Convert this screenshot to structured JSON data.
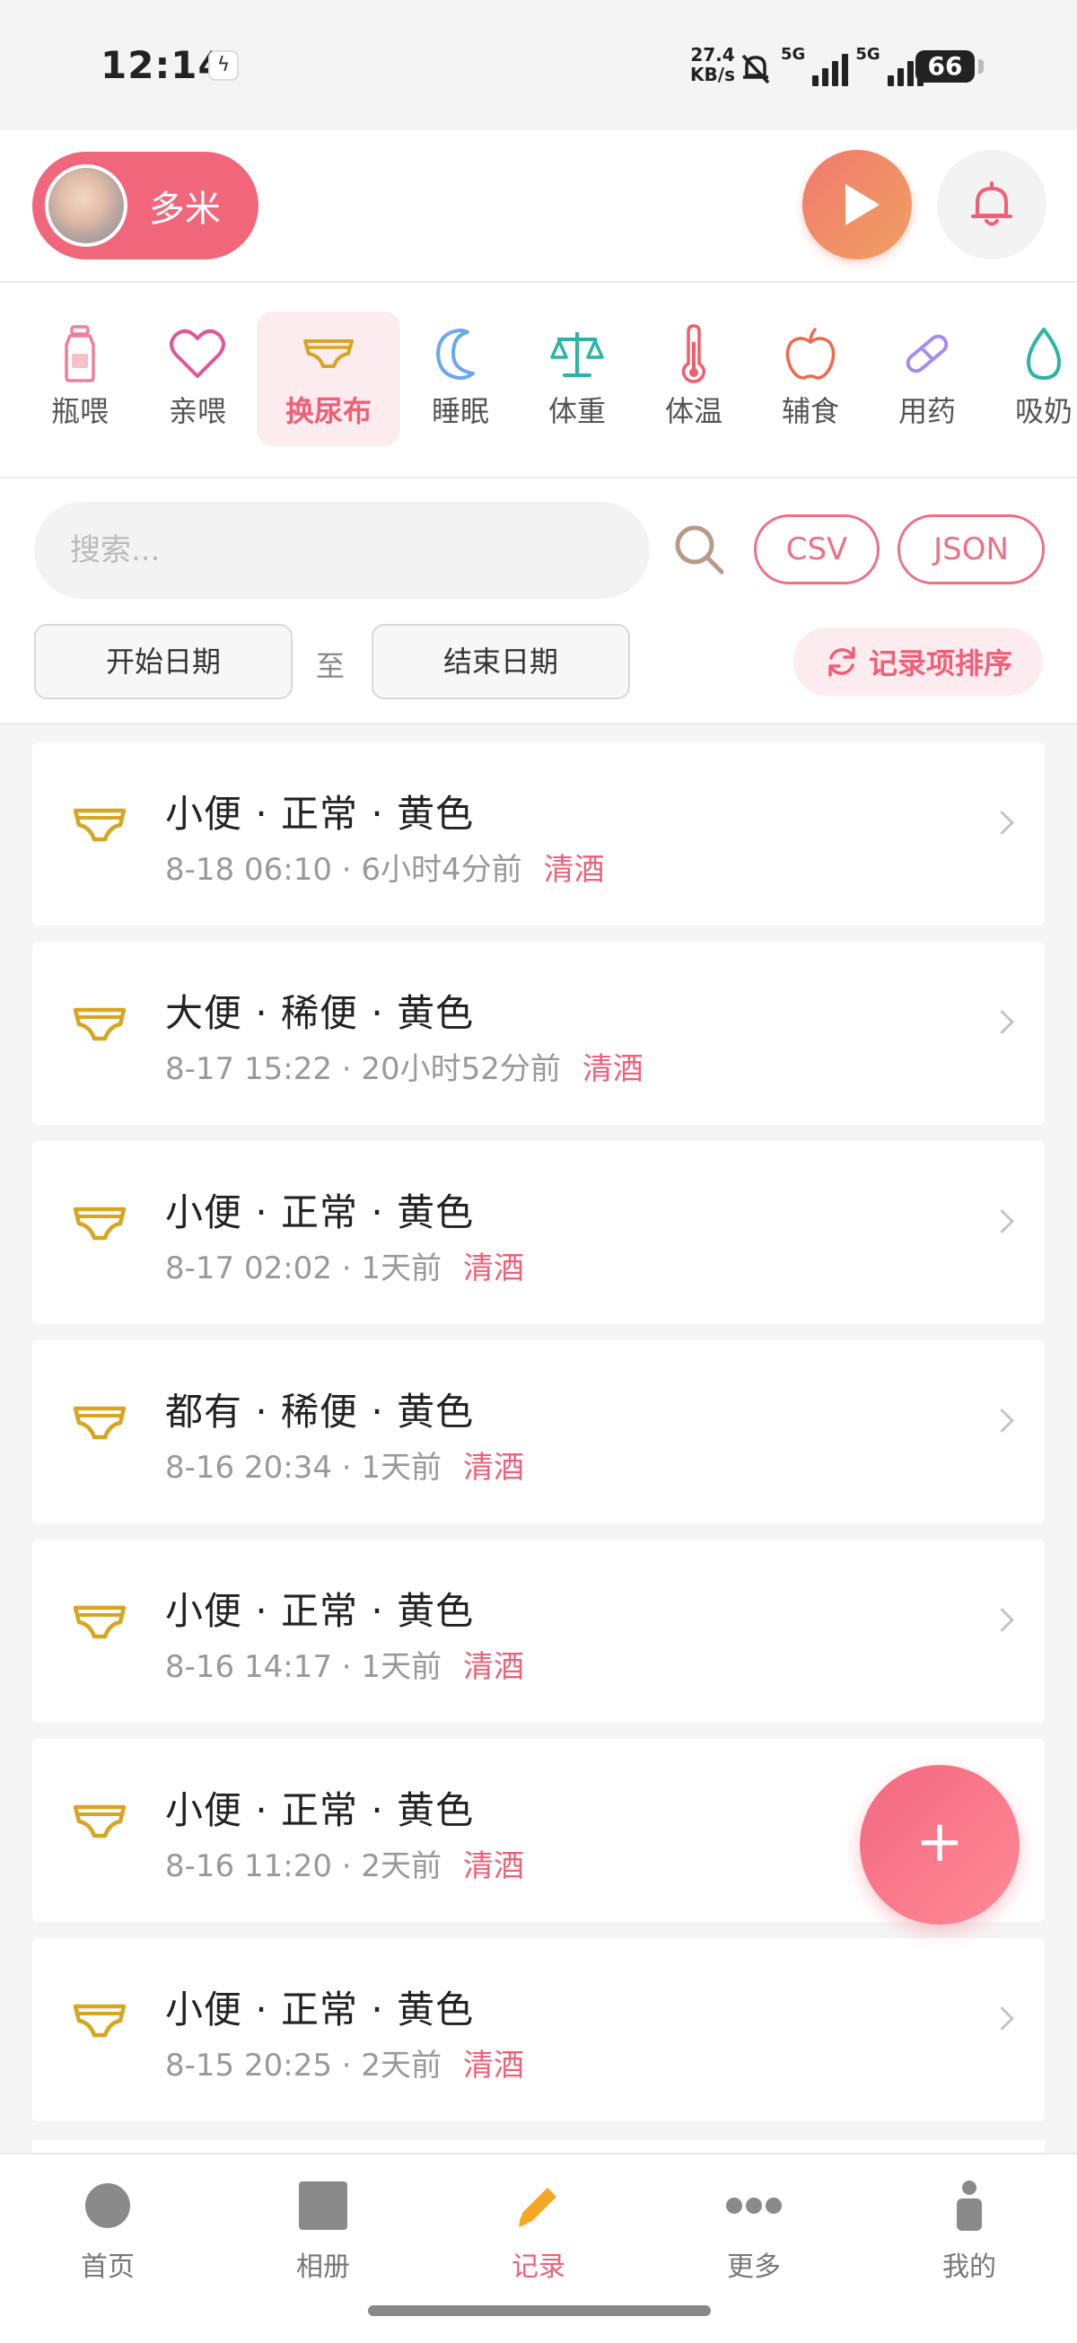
{
  "status_bar": {
    "time": "12:14",
    "speed_value": "27.4",
    "speed_unit": "KB/s",
    "network_1": "5G",
    "network_2": "5G",
    "battery": "66"
  },
  "header": {
    "baby_name": "多米"
  },
  "categories": [
    {
      "label": "瓶喂",
      "icon": "bottle-icon"
    },
    {
      "label": "亲喂",
      "icon": "heart-icon"
    },
    {
      "label": "换尿布",
      "icon": "diaper-icon",
      "active": true
    },
    {
      "label": "睡眠",
      "icon": "moon-icon"
    },
    {
      "label": "体重",
      "icon": "scale-icon"
    },
    {
      "label": "体温",
      "icon": "thermometer-icon"
    },
    {
      "label": "辅食",
      "icon": "apple-icon"
    },
    {
      "label": "用药",
      "icon": "pill-icon"
    },
    {
      "label": "吸奶",
      "icon": "drop-icon"
    }
  ],
  "filter": {
    "search_placeholder": "搜索...",
    "csv_label": "CSV",
    "json_label": "JSON",
    "start_date": "开始日期",
    "separator": "至",
    "end_date": "结束日期",
    "sort_label": "记录项排序"
  },
  "records": [
    {
      "title": "小便 · 正常 · 黄色",
      "time": "8-18 06:10 · 6小时4分前",
      "who": "清酒"
    },
    {
      "title": "大便 · 稀便 · 黄色",
      "time": "8-17 15:22 · 20小时52分前",
      "who": "清酒"
    },
    {
      "title": "小便 · 正常 · 黄色",
      "time": "8-17 02:02 · 1天前",
      "who": "清酒"
    },
    {
      "title": "都有 · 稀便 · 黄色",
      "time": "8-16 20:34 · 1天前",
      "who": "清酒"
    },
    {
      "title": "小便 · 正常 · 黄色",
      "time": "8-16 14:17 · 1天前",
      "who": "清酒"
    },
    {
      "title": "小便 · 正常 · 黄色",
      "time": "8-16 11:20 · 2天前",
      "who": "清酒"
    },
    {
      "title": "小便 · 正常 · 黄色",
      "time": "8-15 20:25 · 2天前",
      "who": "清酒"
    }
  ],
  "fab_label": "+",
  "nav": [
    {
      "label": "首页",
      "icon": "home-icon"
    },
    {
      "label": "相册",
      "icon": "album-icon"
    },
    {
      "label": "记录",
      "icon": "pencil-icon",
      "active": true
    },
    {
      "label": "更多",
      "icon": "more-icon"
    },
    {
      "label": "我的",
      "icon": "profile-icon"
    }
  ],
  "colors": {
    "accent": "#ef5f78",
    "diaper_icon": "#d8a520",
    "muted_text": "#999999"
  }
}
